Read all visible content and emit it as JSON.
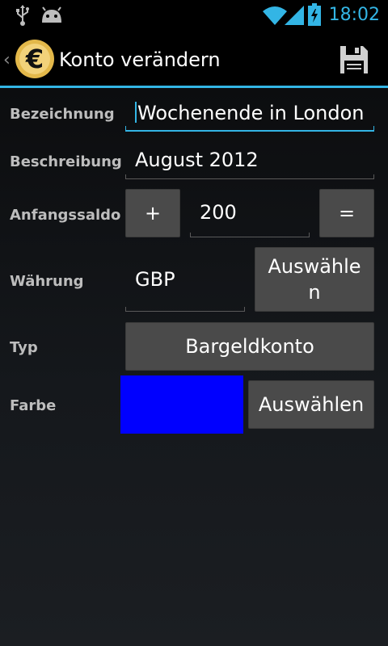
{
  "status_bar": {
    "time": "18:02",
    "icons": [
      "usb-icon",
      "android-debug-icon",
      "wifi-icon",
      "signal-icon",
      "battery-charging-icon"
    ]
  },
  "action_bar": {
    "title": "Konto verändern",
    "logo_icon": "euro-coin-icon",
    "save_icon": "floppy-disk-icon"
  },
  "form": {
    "name": {
      "label": "Bezeichnung",
      "value": "Wochenende in London"
    },
    "description": {
      "label": "Beschreibung",
      "value": "August 2012"
    },
    "initial_balance": {
      "label": "Anfangssaldo",
      "sign_button": "+",
      "value": "200",
      "equals_button": "="
    },
    "currency": {
      "label": "Währung",
      "value": "GBP",
      "select_button": "Auswähle\nn"
    },
    "type": {
      "label": "Typ",
      "button": "Bargeldkonto"
    },
    "color": {
      "label": "Farbe",
      "swatch": "#0000ff",
      "select_button": "Auswählen"
    }
  },
  "colors": {
    "accent": "#33b5e5",
    "button": "#4a4a4a",
    "label": "#bdbdbd"
  }
}
